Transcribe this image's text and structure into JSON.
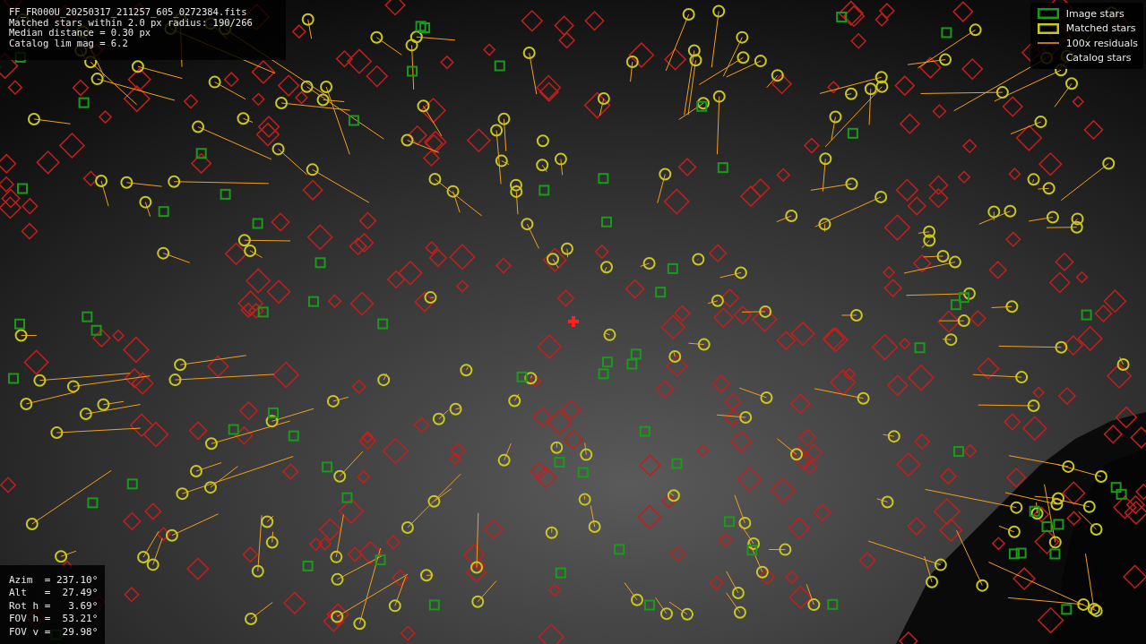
{
  "info_lines": [
    "FF_FR000U_20250317_211257_605_0272384.fits",
    "Matched stars within 2.0 px radius: 190/266",
    "Median distance = 0.30 px",
    "Catalog lim mag = 6.2"
  ],
  "legend": [
    {
      "kind": "image",
      "label": "Image stars"
    },
    {
      "kind": "matched",
      "label": "Matched stars"
    },
    {
      "kind": "residual",
      "label": "100x residuals"
    },
    {
      "kind": "catalog",
      "label": "Catalog stars"
    }
  ],
  "pointing": [
    "Azim  = 237.10°",
    "Alt   =  27.49°",
    "Rot h =   3.69°",
    "FOV h =  53.21°",
    "FOV v =  29.98°"
  ]
}
